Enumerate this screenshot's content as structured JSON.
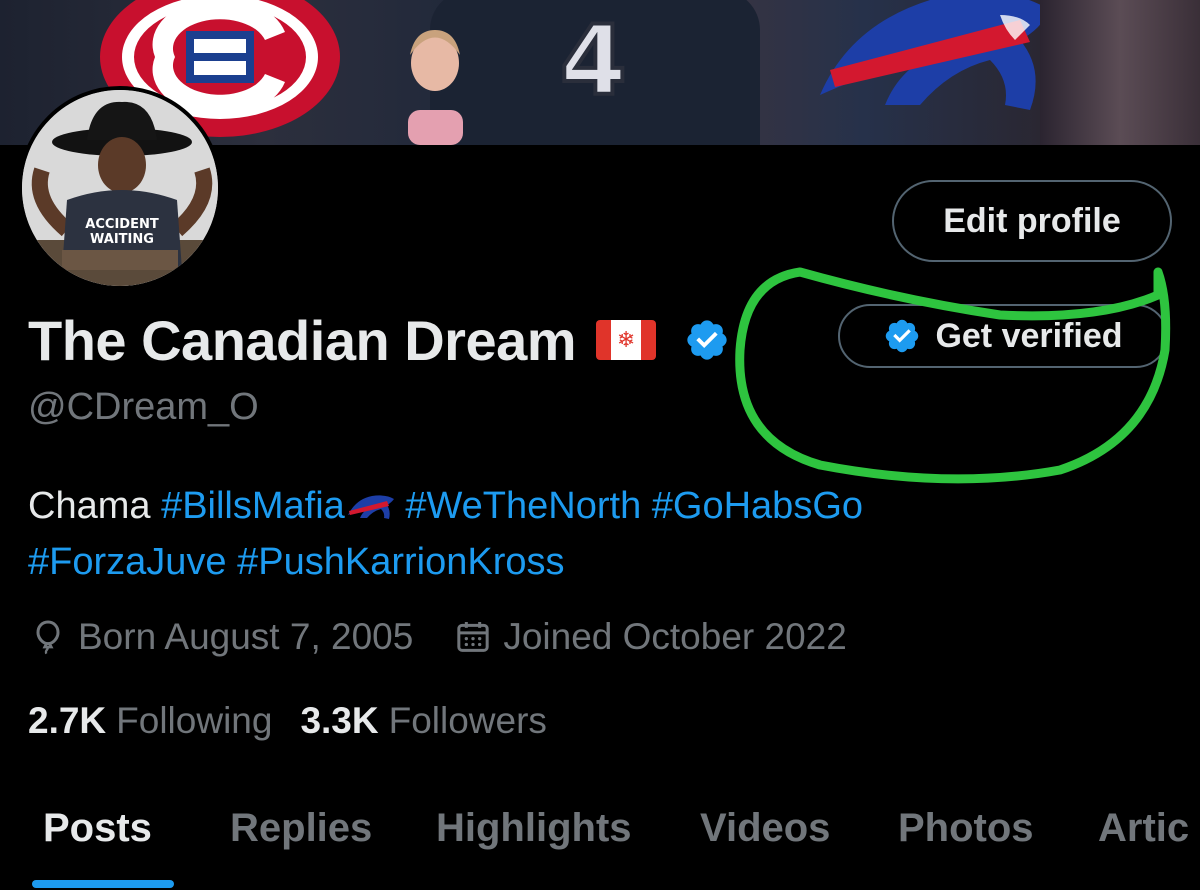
{
  "banner": {
    "jersey_number": "4"
  },
  "profile": {
    "display_name": "The Canadian Dream",
    "handle": "@CDream_O",
    "avatar_shirt_text_line1": "ACCIDENT",
    "avatar_shirt_text_line2": "WAITING"
  },
  "actions": {
    "edit_profile_label": "Edit profile",
    "get_verified_label": "Get verified"
  },
  "bio": {
    "plain_prefix": "Chama",
    "hashtags": [
      "#BillsMafia",
      "#WeTheNorth",
      "#GoHabsGo",
      "#ForzaJuve",
      "#PushKarrionKross"
    ]
  },
  "meta": {
    "birth": "Born August 7, 2005",
    "joined": "Joined October 2022"
  },
  "stats": {
    "following_count": "2.7K",
    "following_label": "Following",
    "followers_count": "3.3K",
    "followers_label": "Followers"
  },
  "tabs": [
    "Posts",
    "Replies",
    "Highlights",
    "Videos",
    "Photos",
    "Artic"
  ],
  "colors": {
    "accent": "#1d9bf0",
    "background": "#000000",
    "muted_text": "#71767b",
    "primary_text": "#e7e9ea",
    "annotation_green": "#2ec43f"
  },
  "icons": [
    "verified-badge-icon",
    "canada-flag-icon",
    "birthday-balloon-icon",
    "calendar-icon",
    "bills-logo-icon"
  ]
}
